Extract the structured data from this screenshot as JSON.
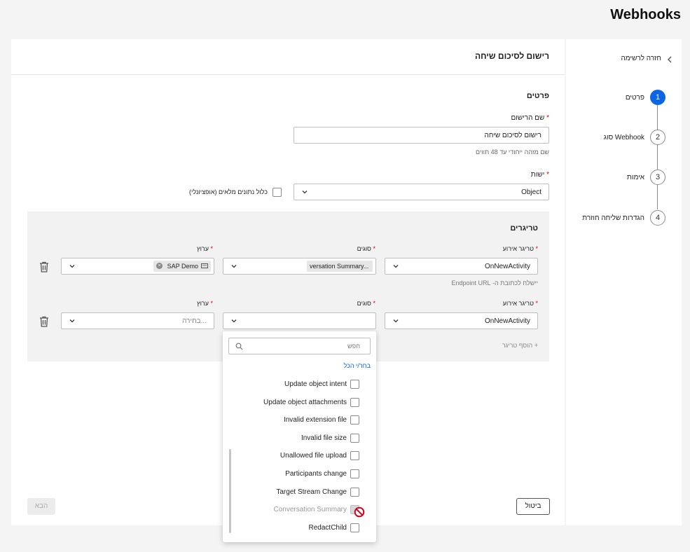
{
  "page_title": "Webhooks",
  "sidebar": {
    "back_label": "חזרה לרשימה",
    "steps": [
      {
        "number": "1",
        "label": "פרטים",
        "active": true
      },
      {
        "number": "2",
        "label": "סוג Webhook",
        "active": false
      },
      {
        "number": "3",
        "label": "אימות",
        "active": false
      },
      {
        "number": "4",
        "label": "הגדרות שליחה חוזרת",
        "active": false
      }
    ]
  },
  "form": {
    "header": "רישום לסיכום שיחה",
    "section_title": "פרטים",
    "registration_name_label": "שם הרישום",
    "required_mark": "*",
    "registration_name_value": "רישום לסיכום שיחה",
    "registration_name_hint": "שם מזהה ייחודי עד 48 תווים",
    "entity_label": "ישות",
    "entity_value": "Object",
    "full_data_label": "כלול נתונים מלאים (אופציונלי)"
  },
  "triggers": {
    "title": "טריגרים",
    "rows": [
      {
        "event_label": "טריגר אירוע",
        "event_value": "OnNewActivity",
        "types_label": "סוגים",
        "types_chip": "versation Summary...",
        "channel_label": "ערוץ",
        "channel_chip": "SAP Demo",
        "note": "יישלח לכתובת ה- Endpoint URL"
      },
      {
        "event_label": "טריגר אירוע",
        "event_value": "OnNewActivity",
        "types_label": "סוגים",
        "channel_label": "ערוץ",
        "channel_placeholder": "בחירה..."
      }
    ],
    "add_label": "+ הוסף טריגר"
  },
  "dropdown": {
    "search_placeholder": "חפש",
    "select_all": "בחר/י הכל",
    "items": [
      {
        "label": "Update object intent",
        "checked": false,
        "disabled": false
      },
      {
        "label": "Update object attachments",
        "checked": false,
        "disabled": false
      },
      {
        "label": "Invalid extension file",
        "checked": false,
        "disabled": false
      },
      {
        "label": "Invalid file size",
        "checked": false,
        "disabled": false
      },
      {
        "label": "Unallowed file upload",
        "checked": false,
        "disabled": false
      },
      {
        "label": "Participants change",
        "checked": false,
        "disabled": false
      },
      {
        "label": "Target Stream Change",
        "checked": false,
        "disabled": false
      },
      {
        "label": "Conversation Summary",
        "checked": true,
        "disabled": true
      },
      {
        "label": "RedactChild",
        "checked": false,
        "disabled": false
      }
    ]
  },
  "footer": {
    "cancel_label": "ביטול",
    "next_label": "הבא"
  },
  "colors": {
    "accent": "#0b66e4",
    "required": "#d0021b",
    "blocked": "#d0021b"
  }
}
